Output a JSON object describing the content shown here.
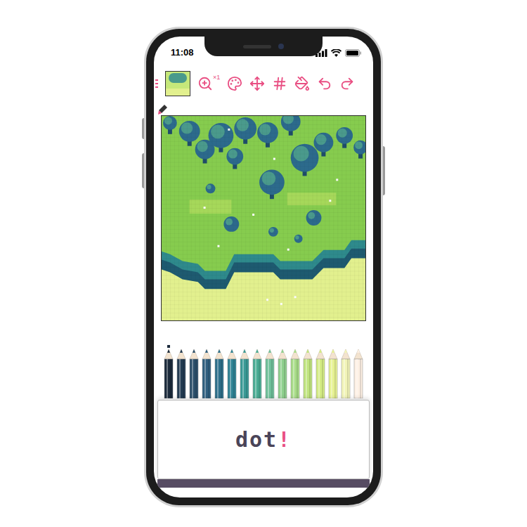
{
  "status_bar": {
    "time": "11:08"
  },
  "toolbar": {
    "zoom_level": "×1"
  },
  "palette": [
    {
      "color": "#1b2a3b",
      "selected": true
    },
    {
      "color": "#233b52",
      "selected": false
    },
    {
      "color": "#2b4f6b",
      "selected": false
    },
    {
      "color": "#2f5f7f",
      "selected": false
    },
    {
      "color": "#2d6f8a",
      "selected": false
    },
    {
      "color": "#2f8294",
      "selected": false
    },
    {
      "color": "#3a9a96",
      "selected": false
    },
    {
      "color": "#4aac94",
      "selected": false
    },
    {
      "color": "#6ec09a",
      "selected": false
    },
    {
      "color": "#8fd08e",
      "selected": false
    },
    {
      "color": "#a8dc88",
      "selected": false
    },
    {
      "color": "#c0e47e",
      "selected": false
    },
    {
      "color": "#d4ec84",
      "selected": false
    },
    {
      "color": "#e6f292",
      "selected": false
    },
    {
      "color": "#f2f4b8",
      "selected": false
    },
    {
      "color": "#fdf0e4",
      "selected": false
    }
  ],
  "logo": [
    {
      "text": "dot",
      "color": "#4a4458"
    },
    {
      "text": "!",
      "color": "#e94f83"
    }
  ]
}
